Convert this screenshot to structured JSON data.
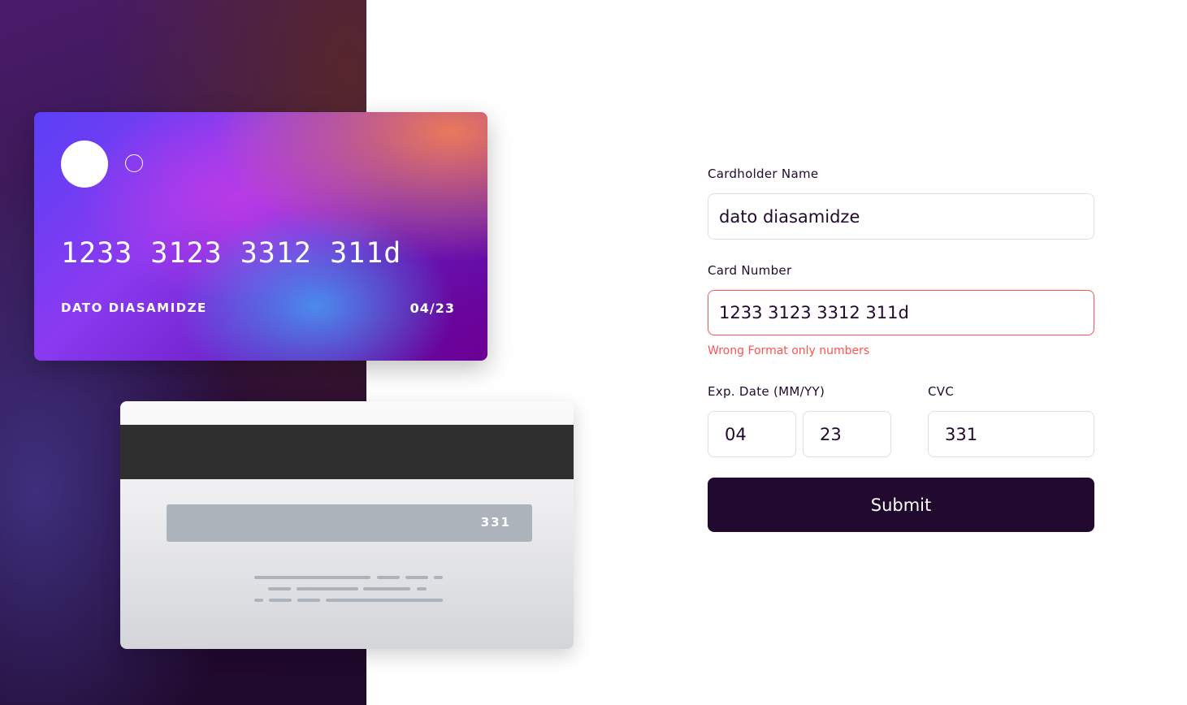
{
  "card_front": {
    "number": "1233 3123 3312 311d",
    "holder_name": "DATO DIASAMIDZE",
    "expiry": "04/23"
  },
  "card_back": {
    "cvc": "331"
  },
  "form": {
    "name_label": "Cardholder Name",
    "name_value": "dato diasamidze",
    "number_label": "Card Number",
    "number_value": "1233 3123 3312 311d",
    "number_error": "Wrong Format only numbers",
    "exp_label": "Exp. Date (MM/YY)",
    "exp_month_value": "04",
    "exp_year_value": "23",
    "cvc_label": "CVC",
    "cvc_value": "331",
    "submit_label": "Submit"
  },
  "colors": {
    "dark_violet": "#21092f",
    "error_red": "#ff5252",
    "field_border": "#dfdee0"
  }
}
